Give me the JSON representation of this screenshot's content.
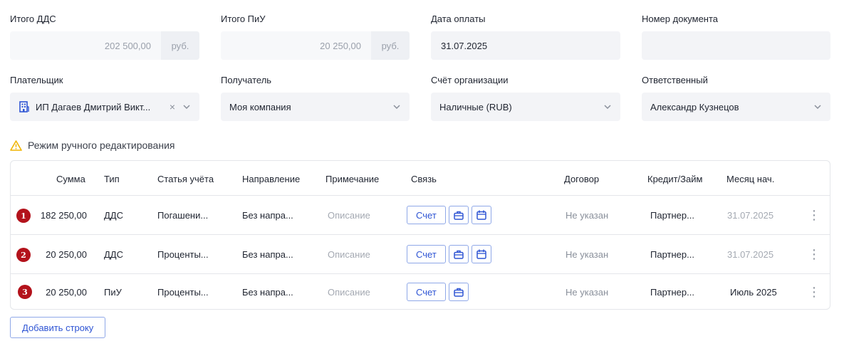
{
  "fields": {
    "total_dds": {
      "label": "Итого ДДС",
      "value": "202 500,00",
      "unit": "руб."
    },
    "total_piu": {
      "label": "Итого ПиУ",
      "value": "20 250,00",
      "unit": "руб."
    },
    "payment_date": {
      "label": "Дата оплаты",
      "value": "31.07.2025"
    },
    "doc_number": {
      "label": "Номер документа",
      "value": ""
    },
    "payer": {
      "label": "Плательщик",
      "value": "ИП Дагаев Дмитрий Викт..."
    },
    "recipient": {
      "label": "Получатель",
      "value": "Моя компания"
    },
    "org_account": {
      "label": "Счёт организации",
      "value": "Наличные (RUB)"
    },
    "responsible": {
      "label": "Ответственный",
      "value": "Александр Кузнецов"
    }
  },
  "manual_mode": "Режим ручного редактирования",
  "table": {
    "headers": {
      "sum": "Сумма",
      "type": "Тип",
      "article": "Статья учёта",
      "direction": "Направление",
      "note": "Примечание",
      "link": "Связь",
      "contract": "Договор",
      "credit": "Кредит/Займ",
      "month": "Месяц нач."
    },
    "rows": [
      {
        "num": "1",
        "sum": "182 250,00",
        "type": "ДДС",
        "article": "Погашени...",
        "direction": "Без напра...",
        "note": "Описание",
        "link": "Счет",
        "contract": "Не указан",
        "credit": "Партнер...",
        "month": "31.07.2025"
      },
      {
        "num": "2",
        "sum": "20 250,00",
        "type": "ДДС",
        "article": "Проценты...",
        "direction": "Без напра...",
        "note": "Описание",
        "link": "Счет",
        "contract": "Не указан",
        "credit": "Партнер...",
        "month": "31.07.2025"
      },
      {
        "num": "3",
        "sum": "20 250,00",
        "type": "ПиУ",
        "article": "Проценты...",
        "direction": "Без напра...",
        "note": "Описание",
        "link": "Счет",
        "contract": "Не указан",
        "credit": "Партнер...",
        "month": "Июль 2025"
      }
    ]
  },
  "add_row_label": "Добавить строку",
  "colors": {
    "accent": "#2f55d4",
    "badge": "#b3121b",
    "warning": "#f0b400"
  }
}
